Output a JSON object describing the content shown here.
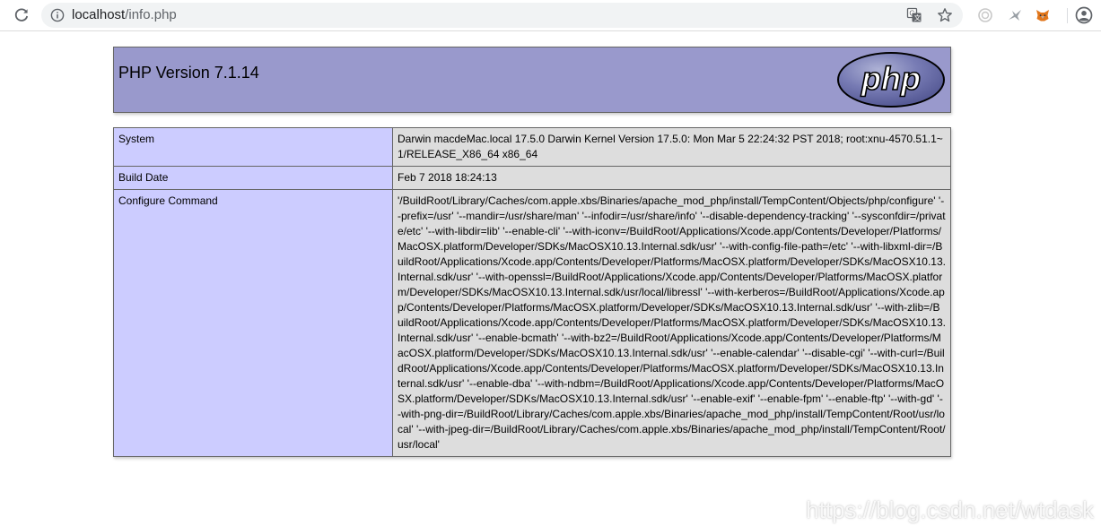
{
  "browser": {
    "url_host": "localhost",
    "url_path": "/info.php",
    "icons": {
      "reload": "reload-icon",
      "site_info": "info-icon",
      "translate": "translate-icon",
      "bookmark": "star-icon",
      "ext1": "extension-circle-icon",
      "ext2": "extension-bird-icon",
      "ext3": "extension-fox-icon",
      "profile": "account-icon"
    }
  },
  "phpinfo": {
    "title": "PHP Version 7.1.14",
    "logo_text": "php",
    "colors": {
      "header_bg": "#9999cc",
      "label_bg": "#ccccff",
      "value_bg": "#dddddd"
    },
    "rows": [
      {
        "label": "System",
        "value": "Darwin macdeMac.local 17.5.0 Darwin Kernel Version 17.5.0: Mon Mar 5 22:24:32 PST 2018; root:xnu-4570.51.1~1/RELEASE_X86_64 x86_64"
      },
      {
        "label": "Build Date",
        "value": "Feb 7 2018 18:24:13"
      },
      {
        "label": "Configure Command",
        "value": "'/BuildRoot/Library/Caches/com.apple.xbs/Binaries/apache_mod_php/install/TempContent/Objects/php/configure' '--prefix=/usr' '--mandir=/usr/share/man' '--infodir=/usr/share/info' '--disable-dependency-tracking' '--sysconfdir=/private/etc' '--with-libdir=lib' '--enable-cli' '--with-iconv=/BuildRoot/Applications/Xcode.app/Contents/Developer/Platforms/MacOSX.platform/Developer/SDKs/MacOSX10.13.Internal.sdk/usr' '--with-config-file-path=/etc' '--with-libxml-dir=/BuildRoot/Applications/Xcode.app/Contents/Developer/Platforms/MacOSX.platform/Developer/SDKs/MacOSX10.13.Internal.sdk/usr' '--with-openssl=/BuildRoot/Applications/Xcode.app/Contents/Developer/Platforms/MacOSX.platform/Developer/SDKs/MacOSX10.13.Internal.sdk/usr/local/libressl' '--with-kerberos=/BuildRoot/Applications/Xcode.app/Contents/Developer/Platforms/MacOSX.platform/Developer/SDKs/MacOSX10.13.Internal.sdk/usr' '--with-zlib=/BuildRoot/Applications/Xcode.app/Contents/Developer/Platforms/MacOSX.platform/Developer/SDKs/MacOSX10.13.Internal.sdk/usr' '--enable-bcmath' '--with-bz2=/BuildRoot/Applications/Xcode.app/Contents/Developer/Platforms/MacOSX.platform/Developer/SDKs/MacOSX10.13.Internal.sdk/usr' '--enable-calendar' '--disable-cgi' '--with-curl=/BuildRoot/Applications/Xcode.app/Contents/Developer/Platforms/MacOSX.platform/Developer/SDKs/MacOSX10.13.Internal.sdk/usr' '--enable-dba' '--with-ndbm=/BuildRoot/Applications/Xcode.app/Contents/Developer/Platforms/MacOSX.platform/Developer/SDKs/MacOSX10.13.Internal.sdk/usr' '--enable-exif' '--enable-fpm' '--enable-ftp' '--with-gd' '--with-png-dir=/BuildRoot/Library/Caches/com.apple.xbs/Binaries/apache_mod_php/install/TempContent/Root/usr/local' '--with-jpeg-dir=/BuildRoot/Library/Caches/com.apple.xbs/Binaries/apache_mod_php/install/TempContent/Root/usr/local'"
      }
    ]
  },
  "watermark": "https://blog.csdn.net/wtdask"
}
